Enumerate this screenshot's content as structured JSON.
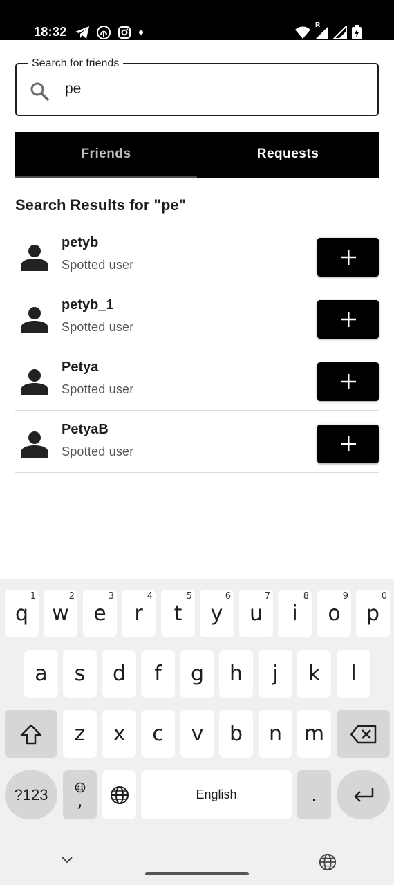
{
  "status_bar": {
    "time": "18:32",
    "left_icons": [
      "telegram-icon",
      "fingerprint-app-icon",
      "instagram-icon",
      "dot-icon"
    ],
    "right_icons": [
      "wifi-icon",
      "signal-roaming-icon",
      "signal-icon",
      "battery-charging-icon"
    ],
    "roaming_label": "R"
  },
  "search": {
    "label": "Search for friends",
    "value": "pe"
  },
  "tabs": [
    {
      "label": "Friends",
      "selected": true
    },
    {
      "label": "Requests",
      "selected": false
    }
  ],
  "results": {
    "title": "Search Results for \"pe\"",
    "items": [
      {
        "name": "petyb",
        "subtitle": "Spotted user"
      },
      {
        "name": "petyb_1",
        "subtitle": "Spotted user"
      },
      {
        "name": "Petya",
        "subtitle": "Spotted user"
      },
      {
        "name": "PetyaB",
        "subtitle": "Spotted user"
      }
    ]
  },
  "keyboard": {
    "row1": [
      {
        "k": "q",
        "h": "1"
      },
      {
        "k": "w",
        "h": "2"
      },
      {
        "k": "e",
        "h": "3"
      },
      {
        "k": "r",
        "h": "4"
      },
      {
        "k": "t",
        "h": "5"
      },
      {
        "k": "y",
        "h": "6"
      },
      {
        "k": "u",
        "h": "7"
      },
      {
        "k": "i",
        "h": "8"
      },
      {
        "k": "o",
        "h": "9"
      },
      {
        "k": "p",
        "h": "0"
      }
    ],
    "row2": [
      "a",
      "s",
      "d",
      "f",
      "g",
      "h",
      "j",
      "k",
      "l"
    ],
    "row3": [
      "z",
      "x",
      "c",
      "v",
      "b",
      "n",
      "m"
    ],
    "symbols_label": "?123",
    "emoji_comma": ",",
    "space_label": "English",
    "period_label": "."
  },
  "colors": {
    "accent": "#000000",
    "tab_inactive_text": "#bdbdbd",
    "keyboard_bg": "#f0f0f0",
    "key_bg": "#ffffff",
    "mod_key_bg": "#d6d6d6"
  }
}
